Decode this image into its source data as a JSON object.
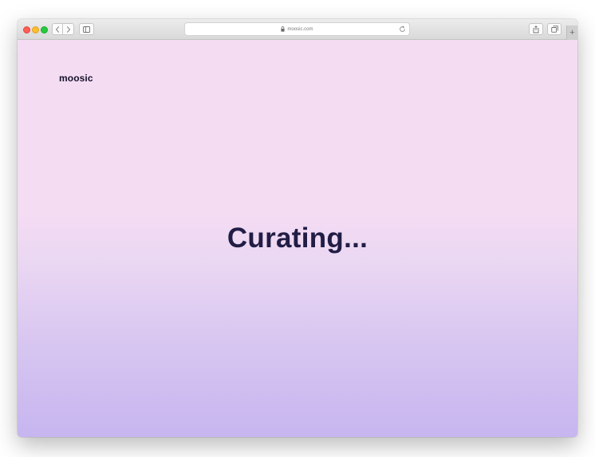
{
  "browser": {
    "url": "moosic.com",
    "new_tab_label": "+"
  },
  "icons": {
    "back": "chevron-left-icon",
    "forward": "chevron-right-icon",
    "sidebar": "sidebar-icon",
    "lock": "lock-icon",
    "reload": "reload-icon",
    "share": "share-icon",
    "tabs": "tabs-overview-icon"
  },
  "page": {
    "logo": "moosic",
    "status": "Curating..."
  },
  "colors": {
    "gradient_top": "#f4dcf3",
    "gradient_bottom": "#c7b5f0",
    "heading": "#211d45"
  }
}
